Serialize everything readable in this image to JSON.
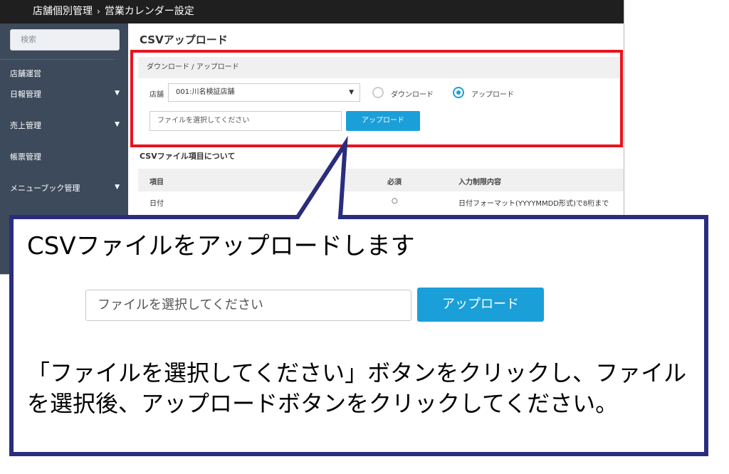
{
  "header": {
    "breadcrumb_parent": "店舗個別管理",
    "breadcrumb_sep": "›",
    "breadcrumb_current": "営業カレンダー設定"
  },
  "sidebar": {
    "search_placeholder": "検索",
    "section_label": "店舗運営",
    "items": [
      {
        "label": "日報管理",
        "chevron": "▼"
      },
      {
        "label": "売上管理",
        "chevron": "▼"
      },
      {
        "label": "帳票管理"
      },
      {
        "label": "メニューブック管理",
        "chevron": "▼"
      }
    ]
  },
  "main": {
    "page_title": "CSVアップロード",
    "panel_title": "ダウンロード / アップロード",
    "shop_label": "店舗",
    "shop_value": "001:川名検証店舗",
    "select_arrow": "▼",
    "radio_download": "ダウンロード",
    "radio_upload": "アップロード",
    "file_placeholder": "ファイルを選択してください",
    "upload_button": "アップロード",
    "section_title": "CSVファイル項目について",
    "table": {
      "headers": [
        "項目",
        "必須",
        "入力制限内容"
      ],
      "rows": [
        [
          "日付",
          "○",
          "日付フォーマット(YYYYMMDD形式)で8桁まで"
        ]
      ]
    }
  },
  "callout": {
    "title": "CSVファイルをアップロードします",
    "file_placeholder": "ファイルを選択してください",
    "upload_button": "アップロード",
    "instruction": "「ファイルを選択してください」ボタンをクリックし、ファイルを選択後、アップロードボタンをクリックしてください。"
  },
  "colors": {
    "highlight": "#e8141e",
    "callout_border": "#2a2d7c",
    "accent": "#1a9fd9",
    "sidebar": "#3d4a5c"
  }
}
